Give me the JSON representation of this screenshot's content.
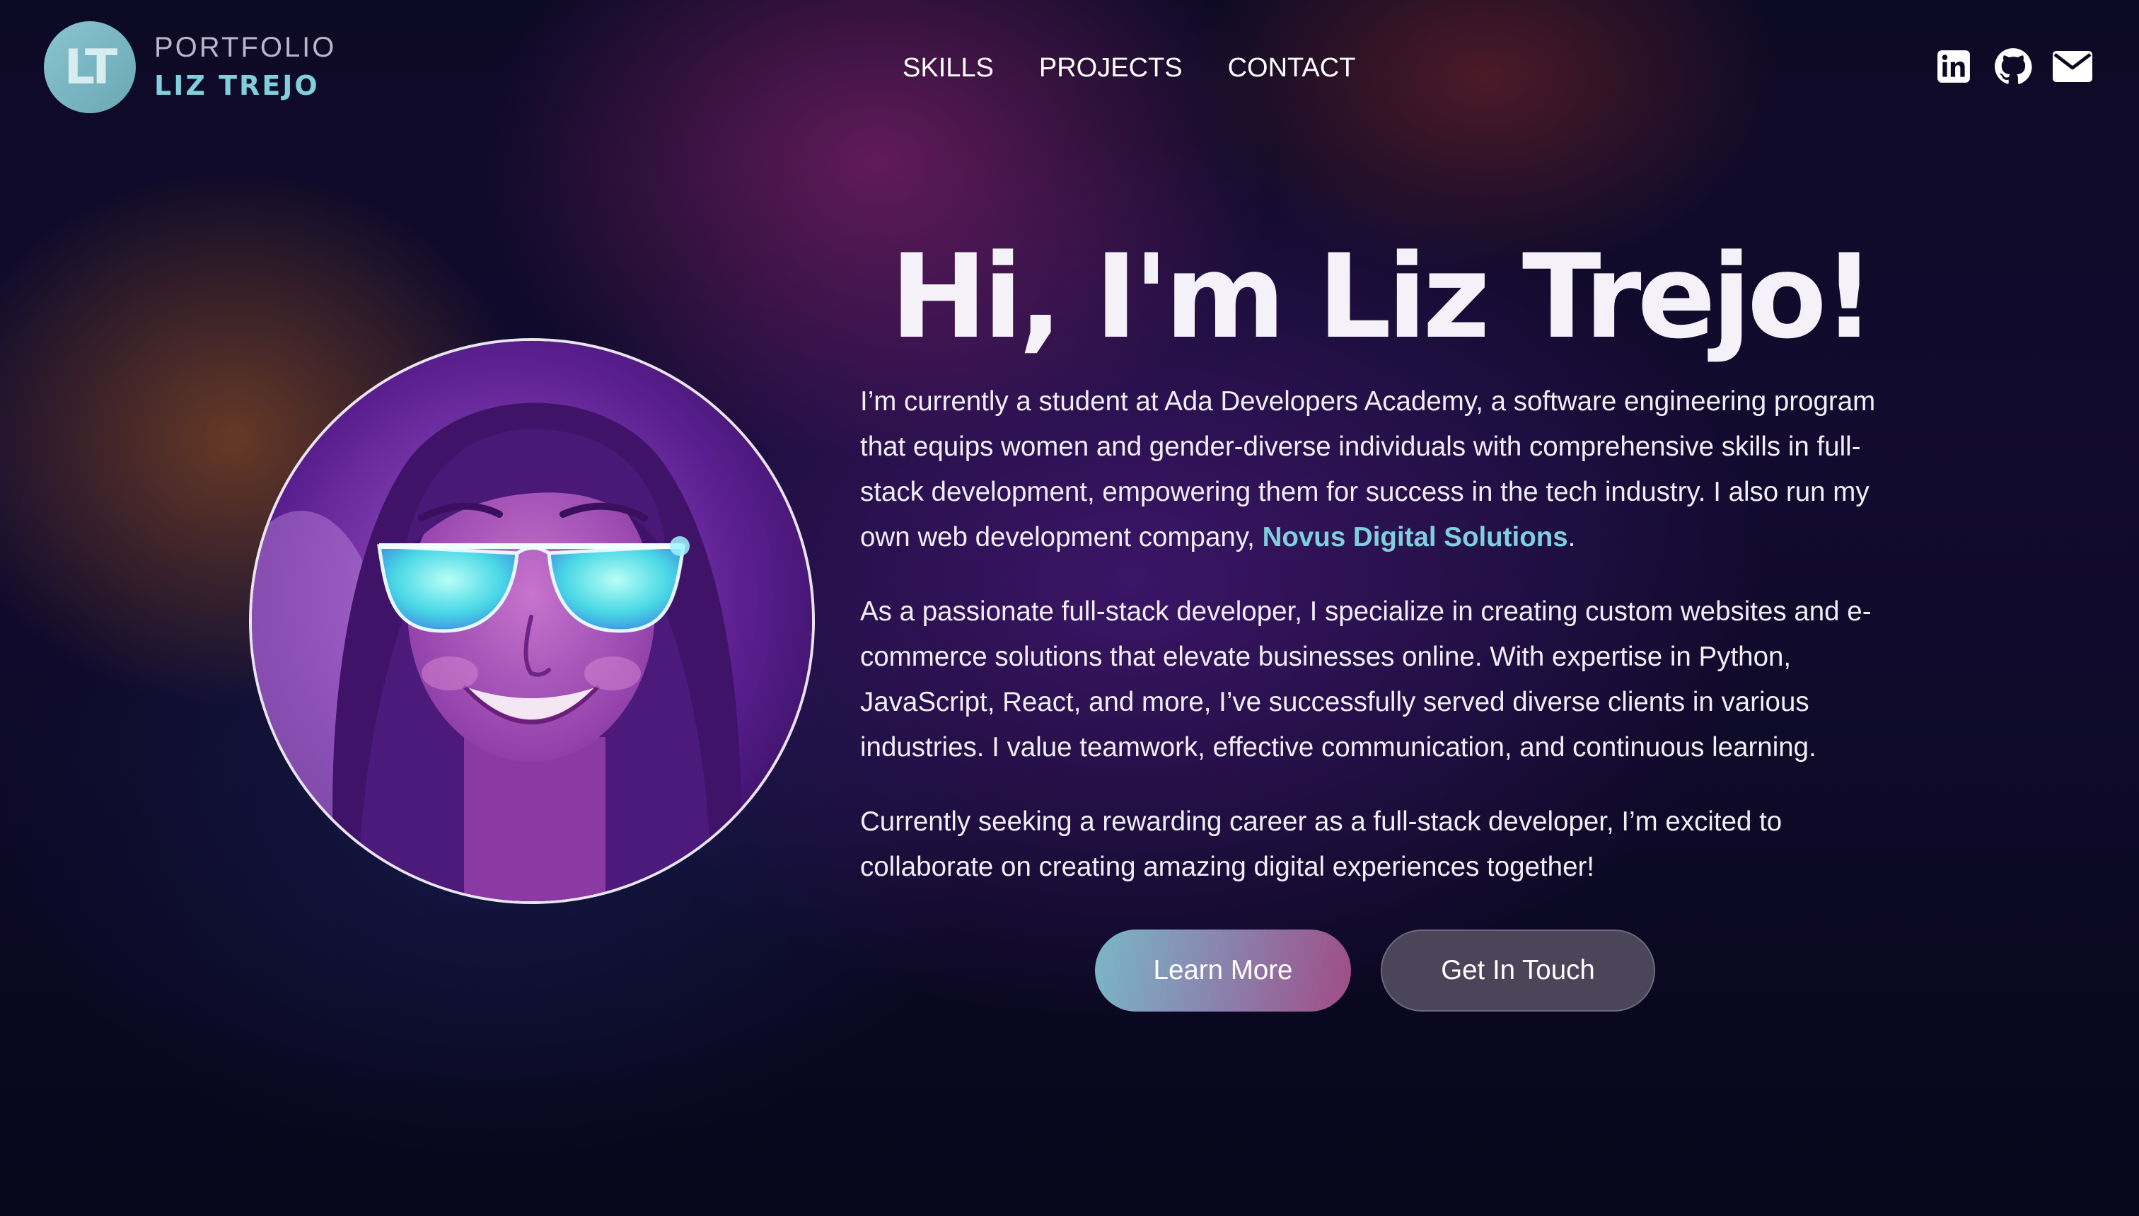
{
  "brand": {
    "initials": "LT",
    "portfolio_label": "PORTFOLIO",
    "name": "LIZ TREJO"
  },
  "nav": {
    "items": [
      {
        "label": "SKILLS"
      },
      {
        "label": "PROJECTS"
      },
      {
        "label": "CONTACT"
      }
    ]
  },
  "social": {
    "icons": [
      "linkedin-icon",
      "github-icon",
      "mail-icon"
    ]
  },
  "hero": {
    "title": "Hi, I'm Liz Trejo!",
    "paragraphs": [
      {
        "text_before": "I’m currently a student at Ada Developers Academy, a software engineering program that equips women and gender-diverse individuals with comprehensive skills in full-stack development, empowering them for success in the tech industry. I also run my own web development company, ",
        "link": "Novus Digital Solutions",
        "text_after": "."
      },
      {
        "text": "As a passionate full-stack developer, I specialize in creating custom websites and e-commerce solutions that elevate businesses online. With expertise in Python, JavaScript, React, and more, I’ve successfully served diverse clients in various industries. I value teamwork, effective communication, and continuous learning."
      },
      {
        "text": "Currently seeking a rewarding career as a full-stack developer, I’m excited to collaborate on creating amazing digital experiences together!"
      }
    ],
    "buttons": {
      "learn_more": "Learn More",
      "get_in_touch": "Get In Touch"
    }
  },
  "colors": {
    "accent_teal": "#7fd0dc",
    "background": "#0b0820",
    "text": "#f4f2f8",
    "button_secondary": "#4a4558"
  }
}
